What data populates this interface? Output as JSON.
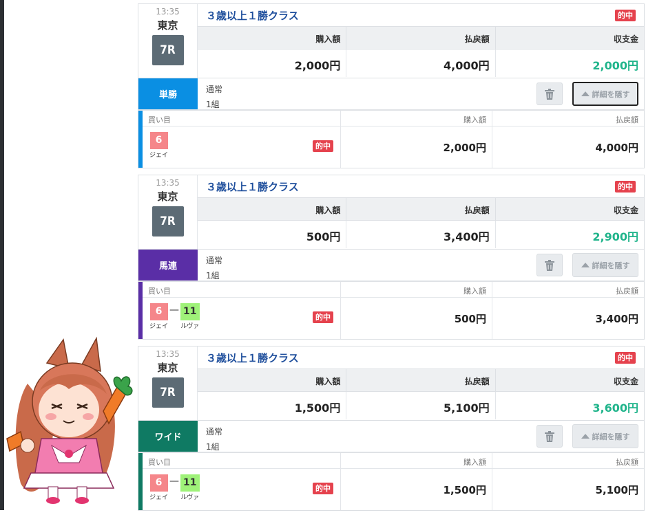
{
  "cards": [
    {
      "time": "13:35",
      "place": "東京",
      "race_number": "7R",
      "race_name": "３歳以上１勝クラス",
      "hit_label": "的中",
      "summary_headers": [
        "購入額",
        "払戻額",
        "収支金"
      ],
      "purchase": "2,000円",
      "payout": "4,000円",
      "balance": "2,000円",
      "bet_type": "単勝",
      "bet_type_color": "#0a8fe3",
      "bet_method": "通常",
      "bet_count": "1組",
      "hide_button": "詳細を隠す",
      "detail_headers": [
        "買い目",
        "購入額",
        "払戻額"
      ],
      "horses": [
        {
          "number": "6",
          "name": "ジェイ",
          "color": "#f5868a"
        }
      ],
      "detail_hit": "的中",
      "detail_purchase": "2,000円",
      "detail_payout": "4,000円"
    },
    {
      "time": "13:35",
      "place": "東京",
      "race_number": "7R",
      "race_name": "３歳以上１勝クラス",
      "hit_label": "的中",
      "summary_headers": [
        "購入額",
        "払戻額",
        "収支金"
      ],
      "purchase": "500円",
      "payout": "3,400円",
      "balance": "2,900円",
      "bet_type": "馬連",
      "bet_type_color": "#5a2ea6",
      "bet_method": "通常",
      "bet_count": "1組",
      "hide_button": "詳細を隠す",
      "detail_headers": [
        "買い目",
        "購入額",
        "払戻額"
      ],
      "horses": [
        {
          "number": "6",
          "name": "ジェイ",
          "color": "#f5868a"
        },
        {
          "number": "11",
          "name": "ルヴァ",
          "color": "#9ff279"
        }
      ],
      "separator": "—",
      "detail_hit": "的中",
      "detail_purchase": "500円",
      "detail_payout": "3,400円"
    },
    {
      "time": "13:35",
      "place": "東京",
      "race_number": "7R",
      "race_name": "３歳以上１勝クラス",
      "hit_label": "的中",
      "summary_headers": [
        "購入額",
        "払戻額",
        "収支金"
      ],
      "purchase": "1,500円",
      "payout": "5,100円",
      "balance": "3,600円",
      "bet_type": "ワイド",
      "bet_type_color": "#0f7a63",
      "bet_method": "通常",
      "bet_count": "1組",
      "hide_button": "詳細を隠す",
      "detail_headers": [
        "買い目",
        "購入額",
        "払戻額"
      ],
      "horses": [
        {
          "number": "6",
          "name": "ジェイ",
          "color": "#f5868a"
        },
        {
          "number": "11",
          "name": "ルヴァ",
          "color": "#9ff279"
        }
      ],
      "separator": "—",
      "detail_hit": "的中",
      "detail_purchase": "1,500円",
      "detail_payout": "5,100円"
    }
  ],
  "icons": {
    "trash": "trash-icon",
    "collapse": "triangle-up-icon"
  },
  "colors": {
    "balance_positive": "#20b48b",
    "hit_badge": "#e5424d",
    "race_title": "#1e4e9c"
  }
}
